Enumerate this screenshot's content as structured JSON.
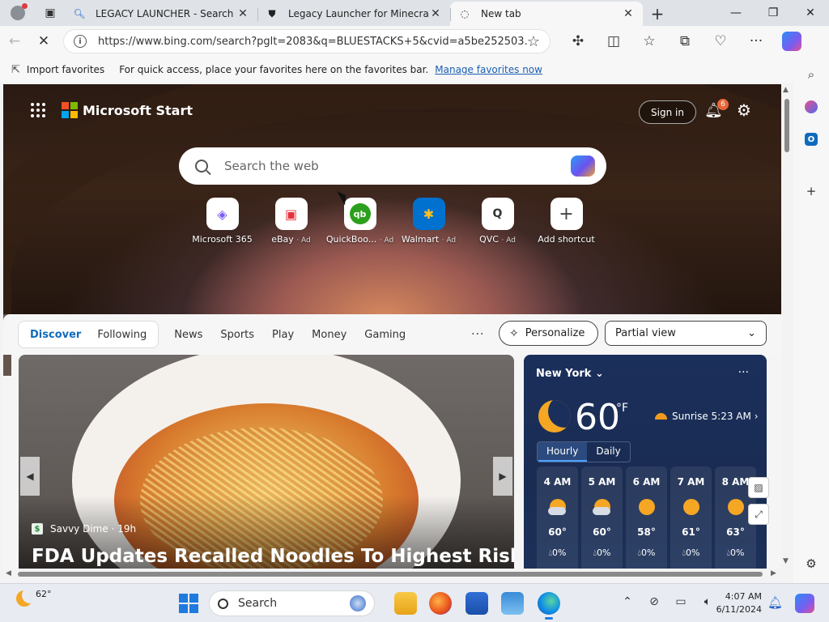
{
  "tabs": [
    {
      "title": "LEGACY LAUNCHER - Search",
      "icon": "search-icon"
    },
    {
      "title": "Legacy Launcher for Minecraft",
      "icon": "shield-icon"
    },
    {
      "title": "New tab",
      "icon": "loading-icon"
    }
  ],
  "address": {
    "url": "https://www.bing.com/search?pglt=2083&q=BLUESTACKS+5&cvid=a5be252503..."
  },
  "favorites_bar": {
    "import_label": "Import favorites",
    "message": "For quick access, place your favorites here on the favorites bar.",
    "manage_link": "Manage favorites now"
  },
  "header": {
    "brand": "Microsoft Start",
    "sign_in": "Sign in",
    "notifications_count": "6"
  },
  "search": {
    "placeholder": "Search the web"
  },
  "shortcuts": [
    {
      "label": "Microsoft 365",
      "ad": "",
      "glyph": "◈"
    },
    {
      "label": "eBay",
      "ad": "· Ad",
      "glyph": "▣"
    },
    {
      "label": "QuickBoo...",
      "ad": "· Ad",
      "glyph": "qb"
    },
    {
      "label": "Walmart",
      "ad": "· Ad",
      "glyph": "✱"
    },
    {
      "label": "QVC",
      "ad": "· Ad",
      "glyph": "Q"
    },
    {
      "label": "Add shortcut",
      "ad": "",
      "glyph": "+"
    }
  ],
  "feed": {
    "pill": [
      "Discover",
      "Following"
    ],
    "links": [
      "News",
      "Sports",
      "Play",
      "Money",
      "Gaming"
    ],
    "more": "···",
    "personalize": "Personalize",
    "view": "Partial view"
  },
  "story": {
    "source": "Savvy Dime",
    "age": "19h",
    "headline": "FDA Updates Recalled Noodles To Highest Risk Level"
  },
  "weather": {
    "city": "New York",
    "temp": "60",
    "unit": "°F",
    "sunrise": "Sunrise 5:23 AM",
    "tabs": [
      "Hourly",
      "Daily"
    ],
    "hours": [
      {
        "time": "4 AM",
        "temp": "60°",
        "precip": "0%",
        "icon": "moon-cloud-icon"
      },
      {
        "time": "5 AM",
        "temp": "60°",
        "precip": "0%",
        "icon": "moon-cloud-icon"
      },
      {
        "time": "6 AM",
        "temp": "58°",
        "precip": "0%",
        "icon": "sun-icon"
      },
      {
        "time": "7 AM",
        "temp": "61°",
        "precip": "0%",
        "icon": "sun-icon"
      },
      {
        "time": "8 AM",
        "temp": "63°",
        "precip": "0%",
        "icon": "sun-icon"
      }
    ]
  },
  "taskbar": {
    "weather_temp": "62°",
    "search_label": "Search",
    "time": "4:07 AM",
    "date": "6/11/2024"
  },
  "colors": {
    "accent": "#0f6cbd",
    "link": "#1a5fb4",
    "badge": "#e8673a",
    "weather_bg": "#1b2f5c"
  }
}
